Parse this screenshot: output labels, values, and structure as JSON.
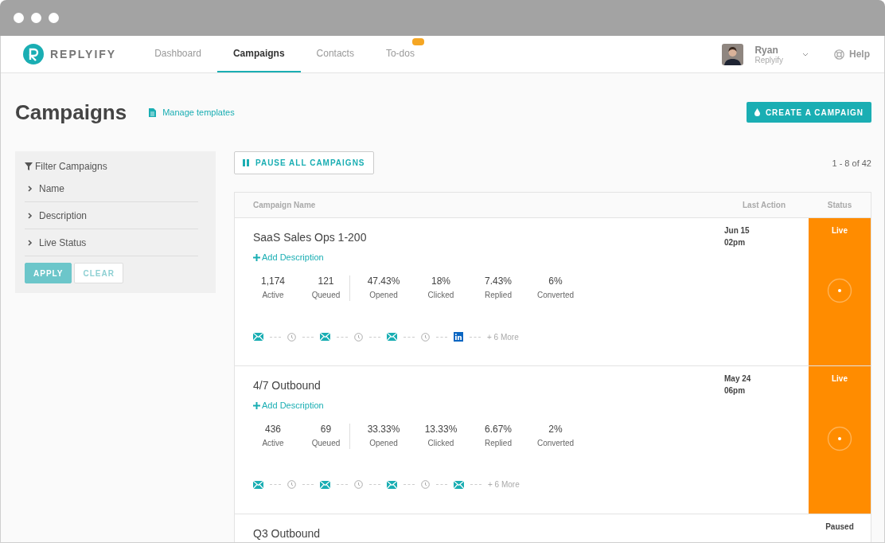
{
  "brand": "REPLYIFY",
  "nav": [
    {
      "label": "Dashboard",
      "selected": false,
      "badge": false
    },
    {
      "label": "Campaigns",
      "selected": true,
      "badge": false
    },
    {
      "label": "Contacts",
      "selected": false,
      "badge": false
    },
    {
      "label": "To-dos",
      "selected": false,
      "badge": true
    }
  ],
  "user": {
    "name": "Ryan",
    "company": "Replyify"
  },
  "help": "Help",
  "page_title": "Campaigns",
  "manage_templates": "Manage templates",
  "create_button": "CREATE A CAMPAIGN",
  "filter": {
    "title": "Filter Campaigns",
    "sections": [
      {
        "label": "Name",
        "expanded": false
      },
      {
        "label": "Description",
        "expanded": false
      },
      {
        "label": "Live Status",
        "expanded": false
      }
    ],
    "apply": "APPLY",
    "clear": "CLEAR"
  },
  "pause_all": "PAUSE ALL CAMPAIGNS",
  "pagination": "1 - 8 of 42",
  "table": {
    "columns": [
      "Campaign Name",
      "Last Action",
      "Status"
    ],
    "rows": [
      {
        "name": "SaaS Sales Ops 1-200",
        "add_description": "Add Description",
        "stats": [
          {
            "value": "1,174",
            "label": "Active"
          },
          {
            "value": "121",
            "label": "Queued"
          },
          {
            "value": "47.43%",
            "label": "Opened"
          },
          {
            "value": "18%",
            "label": "Clicked"
          },
          {
            "value": "7.43%",
            "label": "Replied"
          },
          {
            "value": "6%",
            "label": "Converted"
          }
        ],
        "steps": [
          {
            "kind": "email"
          },
          {
            "kind": "wait"
          },
          {
            "kind": "email"
          },
          {
            "kind": "wait"
          },
          {
            "kind": "email"
          },
          {
            "kind": "wait"
          },
          {
            "kind": "linkedin"
          }
        ],
        "more": "+ 6 More",
        "last_action": [
          "Jun 15",
          "02pm"
        ],
        "status": {
          "label": "Live",
          "kind": "live"
        }
      },
      {
        "name": "4/7 Outbound",
        "add_description": "Add Description",
        "stats": [
          {
            "value": "436",
            "label": "Active"
          },
          {
            "value": "69",
            "label": "Queued"
          },
          {
            "value": "33.33%",
            "label": "Opened"
          },
          {
            "value": "13.33%",
            "label": "Clicked"
          },
          {
            "value": "6.67%",
            "label": "Replied"
          },
          {
            "value": "2%",
            "label": "Converted"
          }
        ],
        "steps": [
          {
            "kind": "email"
          },
          {
            "kind": "wait"
          },
          {
            "kind": "email"
          },
          {
            "kind": "wait"
          },
          {
            "kind": "email"
          },
          {
            "kind": "wait"
          },
          {
            "kind": "email"
          }
        ],
        "more": "+ 6 More",
        "last_action": [
          "May 24",
          "06pm"
        ],
        "status": {
          "label": "Live",
          "kind": "live"
        }
      },
      {
        "name": "Q3 Outbound",
        "status": {
          "label": "Paused",
          "kind": "paused"
        }
      }
    ]
  }
}
